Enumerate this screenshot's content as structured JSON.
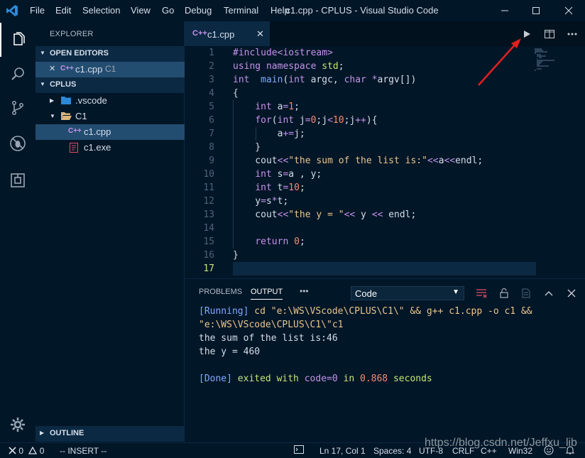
{
  "window": {
    "title": "c1.cpp - CPLUS - Visual Studio Code",
    "menu": [
      "File",
      "Edit",
      "Selection",
      "View",
      "Go",
      "Debug",
      "Terminal",
      "Help"
    ]
  },
  "activity_bar": {
    "items": [
      "explorer-icon",
      "search-icon",
      "source-control-icon",
      "debug-icon",
      "extensions-icon"
    ],
    "bottom": "settings-gear-icon"
  },
  "sidebar": {
    "title": "EXPLORER",
    "open_editors": {
      "header": "OPEN EDITORS",
      "items": [
        {
          "close": "✕",
          "icon": "C++",
          "name": "c1.cpp",
          "folder": "C1"
        }
      ]
    },
    "workspace": {
      "header": "CPLUS",
      "tree": [
        {
          "name": ".vscode",
          "type": "folder",
          "expanded": false
        },
        {
          "name": "C1",
          "type": "folder",
          "expanded": true
        },
        {
          "name": "c1.cpp",
          "type": "file",
          "icon": "C++",
          "selected": true
        },
        {
          "name": "c1.exe",
          "type": "file"
        }
      ]
    },
    "outline_header": "OUTLINE"
  },
  "editor": {
    "tab": {
      "label": "c1.cpp",
      "icon": "C++",
      "close": "✕"
    },
    "line_numbers": [
      "1",
      "2",
      "3",
      "4",
      "5",
      "6",
      "7",
      "8",
      "9",
      "10",
      "11",
      "12",
      "13",
      "14",
      "15",
      "16",
      "17"
    ],
    "current_line": 17
  },
  "panel": {
    "tabs": [
      "PROBLEMS",
      "OUTPUT"
    ],
    "active_tab": "OUTPUT",
    "more": "•••",
    "channel": "Code",
    "output": {
      "running_tag": "[Running]",
      "running_cmd_1": " cd \"e:\\WS\\VScode\\CPLUS\\C1\\\" && g++ c1.cpp -o c1 &&",
      "running_cmd_2": "\"e:\\WS\\VScode\\CPLUS\\C1\\\"c1",
      "line_sum": "the sum of the list is:46",
      "line_y": "the y = 460",
      "done_tag": "[Done]",
      "done_text_1": " exited with ",
      "done_code": "code=0",
      "done_text_2": " in ",
      "done_secs": "0.868",
      "done_text_3": " seconds"
    }
  },
  "status_bar": {
    "errors": "0",
    "warnings": "0",
    "mode": "-- INSERT --",
    "position": "Ln 17, Col 1",
    "spaces": "Spaces: 4",
    "encoding": "UTF-8",
    "eol": "CRLF",
    "language": "C++",
    "platform": "Win32"
  },
  "watermark": "https://blog.csdn.net/Jeffxu_lib",
  "colors": {
    "background": "#011627",
    "accent_selection": "#234d70",
    "keyword": "#c792ea",
    "string": "#ecc48d",
    "number": "#f78c6c",
    "annotation_arrow": "#e02020"
  }
}
